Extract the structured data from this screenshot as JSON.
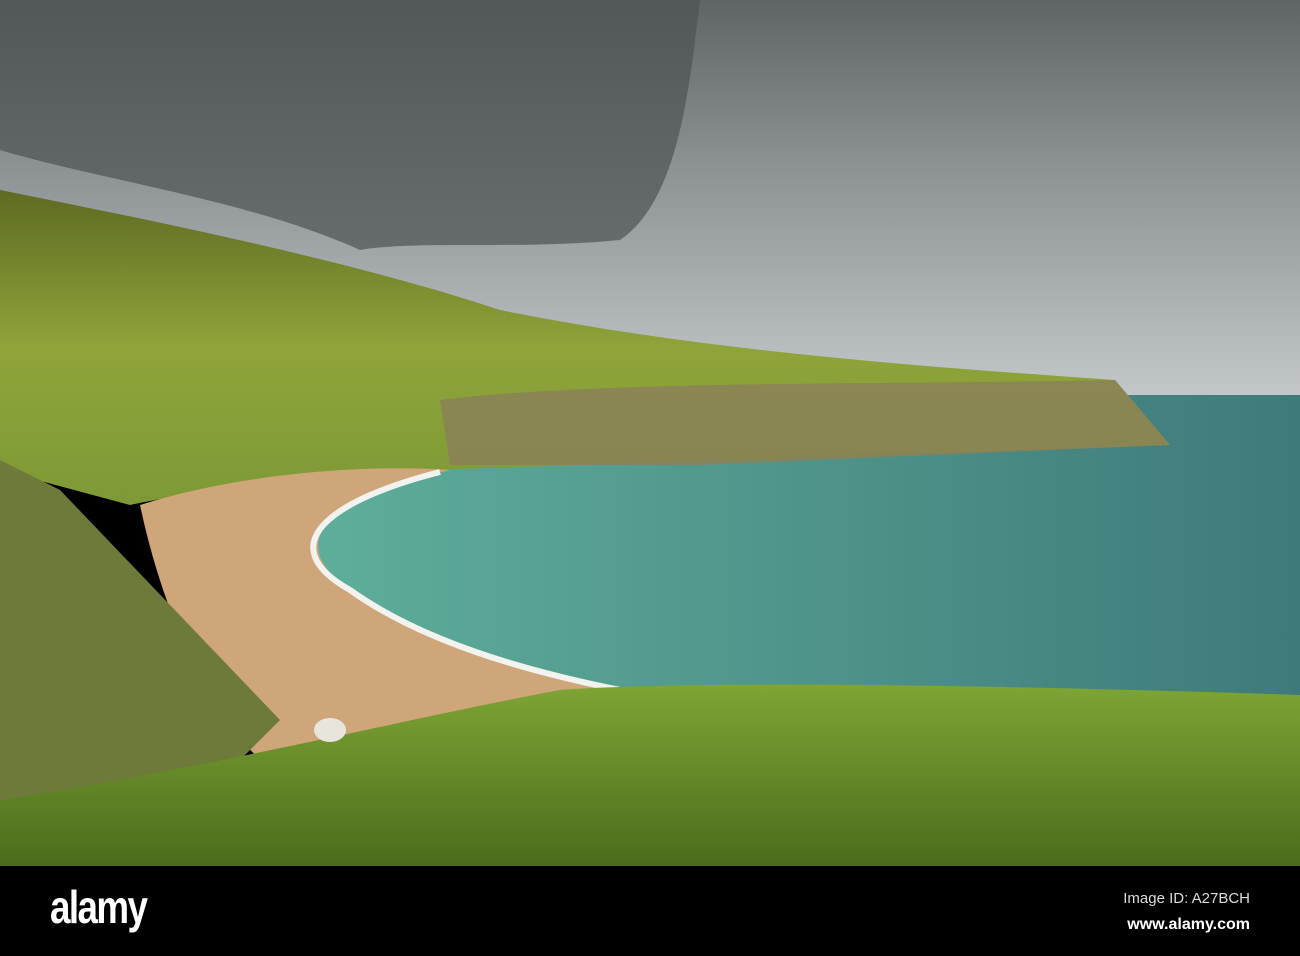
{
  "photo": {
    "subject": "coastal bay with sandy beach, green hills and cliffs under cloudy sky"
  },
  "footer": {
    "logo": "alamy",
    "image_id": "Image ID: A27BCH",
    "url": "www.alamy.com"
  },
  "colors": {
    "sky": "#9ea3a6",
    "sea": "#4f9a8c",
    "grass": "#6e8f2a",
    "sand": "#cfa57a"
  }
}
